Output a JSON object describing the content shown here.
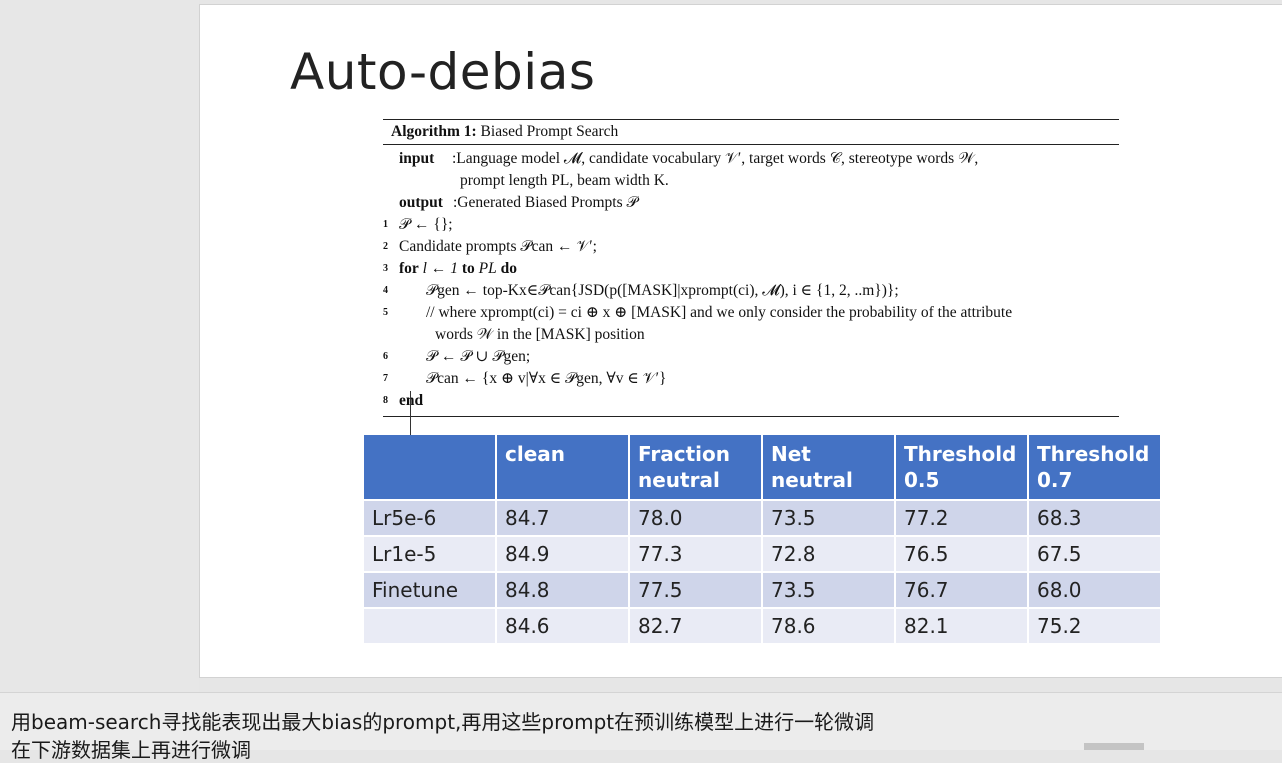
{
  "slide": {
    "title": "Auto-debias"
  },
  "algorithm": {
    "header_bold": "Algorithm 1:",
    "header_text": "Biased Prompt Search",
    "input_label": "input",
    "input_line1": ":Language model 𝓜, candidate vocabulary 𝒱′, target words 𝒞, stereotype words 𝒲,",
    "input_line2": "prompt length PL, beam width K.",
    "output_label": "output",
    "output_text": ":Generated Biased Prompts 𝒫",
    "lines": [
      {
        "num": "1",
        "text": "𝒫 ← {};"
      },
      {
        "num": "2",
        "text": "Candidate prompts 𝒫can ← 𝒱′;"
      },
      {
        "num": "3",
        "text_kw1": "for",
        "text_mid": "l ← 1",
        "text_kw2": "to",
        "text_end": "PL",
        "text_kw3": "do"
      },
      {
        "num": "4",
        "text": "𝒫gen ← top-Kx∈𝒫can{JSD(p([MASK]|xprompt(ci), 𝓜), i ∈ {1, 2, ..m})};"
      },
      {
        "num": "5",
        "text": "// where xprompt(ci) = ci ⊕ x ⊕ [MASK] and we only consider the probability of the attribute"
      },
      {
        "num": "",
        "text": "words 𝒲 in the [MASK] position"
      },
      {
        "num": "6",
        "text": "𝒫 ← 𝒫 ∪ 𝒫gen;"
      },
      {
        "num": "7",
        "text": "𝒫can ← {x ⊕ v|∀x ∈ 𝒫gen, ∀v ∈ 𝒱′}"
      },
      {
        "num": "8",
        "text": "end"
      }
    ]
  },
  "table": {
    "headers": [
      "",
      "clean",
      "Fraction neutral",
      "Net neutral",
      "Threshold 0.5",
      "Threshold 0.7"
    ],
    "header_lines": [
      [
        "",
        ""
      ],
      [
        "clean",
        ""
      ],
      [
        "Fraction",
        "neutral"
      ],
      [
        "Net",
        "neutral"
      ],
      [
        "Threshold",
        "0.5"
      ],
      [
        "Threshold",
        "0.7"
      ]
    ],
    "rows": [
      [
        "Lr5e-6",
        "84.7",
        "78.0",
        "73.5",
        "77.2",
        "68.3"
      ],
      [
        "Lr1e-5",
        "84.9",
        "77.3",
        "72.8",
        "76.5",
        "67.5"
      ],
      [
        "Finetune",
        "84.8",
        "77.5",
        "73.5",
        "76.7",
        "68.0"
      ],
      [
        "",
        "84.6",
        "82.7",
        "78.6",
        "82.1",
        "75.2"
      ]
    ],
    "colors": {
      "header_bg": "#4472c4",
      "row_odd": "#cfd5ea",
      "row_even": "#e9ebf5"
    }
  },
  "subtitles": {
    "line1": "用beam-search寻找能表现出最大bias的prompt,再用这些prompt在预训练模型上进行一轮微调",
    "line2": "在下游数据集上再进行微调"
  }
}
